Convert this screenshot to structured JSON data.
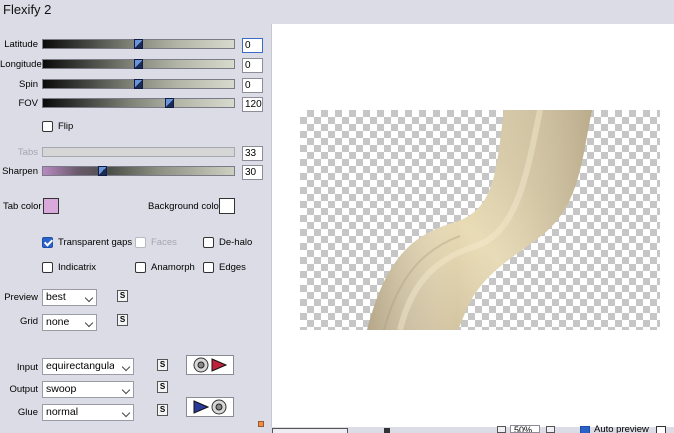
{
  "window": {
    "title": "Flexify 2"
  },
  "sliders": [
    {
      "label": "Latitude",
      "value": "0",
      "level": 0.5
    },
    {
      "label": "Longitude",
      "value": "0",
      "level": 0.5
    },
    {
      "label": "Spin",
      "value": "0",
      "level": 0.5
    },
    {
      "label": "FOV",
      "value": "120",
      "level": 0.67
    }
  ],
  "flip": {
    "label": "Flip",
    "checked": false
  },
  "tabs": {
    "label": "Tabs",
    "value": "33",
    "enabled": false
  },
  "sharpen": {
    "label": "Sharpen",
    "value": "30",
    "level": 0.3
  },
  "colors": {
    "tab_color_label": "Tab color",
    "tab_color_value": "#d9a9dc",
    "background_color_label": "Background color",
    "background_color_value": "#ffffff"
  },
  "options": {
    "transparent_gaps": {
      "label": "Transparent gaps",
      "checked": true
    },
    "faces": {
      "label": "Faces",
      "checked": false,
      "enabled": false
    },
    "de_halo": {
      "label": "De-halo",
      "checked": false
    },
    "indicatrix": {
      "label": "Indicatrix",
      "checked": false
    },
    "anamorph": {
      "label": "Anamorph",
      "checked": false
    },
    "edges": {
      "label": "Edges",
      "checked": false
    }
  },
  "preview_quality": {
    "label": "Preview",
    "value": "best"
  },
  "grid": {
    "label": "Grid",
    "value": "none"
  },
  "input": {
    "label": "Input",
    "value": "equirectangular"
  },
  "output": {
    "label": "Output",
    "value": "swoop"
  },
  "glue": {
    "label": "Glue",
    "value": "normal"
  },
  "small_button_glyph": "S",
  "bottom": {
    "zoom": "50%",
    "auto_preview_label": "Auto preview",
    "auto_preview_checked": true
  }
}
